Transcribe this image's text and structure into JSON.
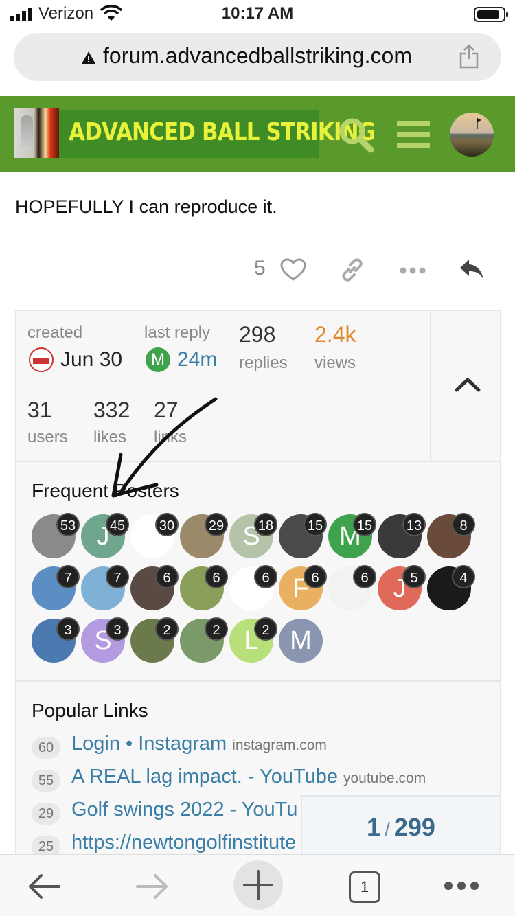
{
  "status": {
    "carrier": "Verizon",
    "time": "10:17 AM"
  },
  "browser": {
    "url": "forum.advancedballstriking.com"
  },
  "header": {
    "logo_text": "ADVANCED BALL STRIKING"
  },
  "post": {
    "text": "HOPEFULLY I can reproduce it.",
    "like_count": "5"
  },
  "topic_map": {
    "created_label": "created",
    "created_value": "Jun 30",
    "last_reply_label": "last reply",
    "last_reply_avatar": "M",
    "last_reply_value": "24m",
    "replies_num": "298",
    "replies_label": "replies",
    "views_num": "2.4k",
    "views_label": "views",
    "users_num": "31",
    "users_label": "users",
    "likes_num": "332",
    "likes_label": "likes",
    "links_num": "27",
    "links_label": "links"
  },
  "frequent_posters": {
    "title": "Frequent Posters",
    "posters": [
      {
        "letter": "",
        "count": "53",
        "color": "#8a8a8a"
      },
      {
        "letter": "J",
        "count": "45",
        "color": "#6fa68e"
      },
      {
        "letter": "",
        "count": "30",
        "color": "#ffffff"
      },
      {
        "letter": "",
        "count": "29",
        "color": "#9b8a6a"
      },
      {
        "letter": "S",
        "count": "18",
        "color": "#b5c4a8"
      },
      {
        "letter": "",
        "count": "15",
        "color": "#4a4a4a"
      },
      {
        "letter": "M",
        "count": "15",
        "color": "#3fa34d"
      },
      {
        "letter": "",
        "count": "13",
        "color": "#3a3a3a"
      },
      {
        "letter": "",
        "count": "8",
        "color": "#6a4a3a"
      },
      {
        "letter": "",
        "count": "7",
        "color": "#5b8fc4"
      },
      {
        "letter": "",
        "count": "7",
        "color": "#7fb0d6"
      },
      {
        "letter": "",
        "count": "6",
        "color": "#5a4a44"
      },
      {
        "letter": "",
        "count": "6",
        "color": "#8aa05a"
      },
      {
        "letter": "",
        "count": "6",
        "color": "#ffffff"
      },
      {
        "letter": "F",
        "count": "6",
        "color": "#e8b060"
      },
      {
        "letter": "",
        "count": "6",
        "color": "#f2f2f2"
      },
      {
        "letter": "J",
        "count": "5",
        "color": "#e06a5a"
      },
      {
        "letter": "",
        "count": "4",
        "color": "#1a1a1a"
      },
      {
        "letter": "",
        "count": "3",
        "color": "#4a7ab0"
      },
      {
        "letter": "S",
        "count": "3",
        "color": "#b49ae0"
      },
      {
        "letter": "",
        "count": "2",
        "color": "#6a7a4a"
      },
      {
        "letter": "",
        "count": "2",
        "color": "#7a9a6a"
      },
      {
        "letter": "L",
        "count": "2",
        "color": "#b8e07a"
      },
      {
        "letter": "M",
        "count": "",
        "color": "#8a96b0"
      }
    ]
  },
  "popular_links": {
    "title": "Popular Links",
    "items": [
      {
        "clicks": "60",
        "title": "Login • Instagram",
        "domain": "instagram.com"
      },
      {
        "clicks": "55",
        "title": "A REAL lag impact. - YouTube",
        "domain": "youtube.com"
      },
      {
        "clicks": "29",
        "title": "Golf swings 2022 - YouTu",
        "domain": ""
      },
      {
        "clicks": "25",
        "title": "https://newtongolfinstitute",
        "domain": ""
      }
    ]
  },
  "progress": {
    "current": "1",
    "total": "299"
  },
  "toolbar": {
    "tab_count": "1"
  }
}
